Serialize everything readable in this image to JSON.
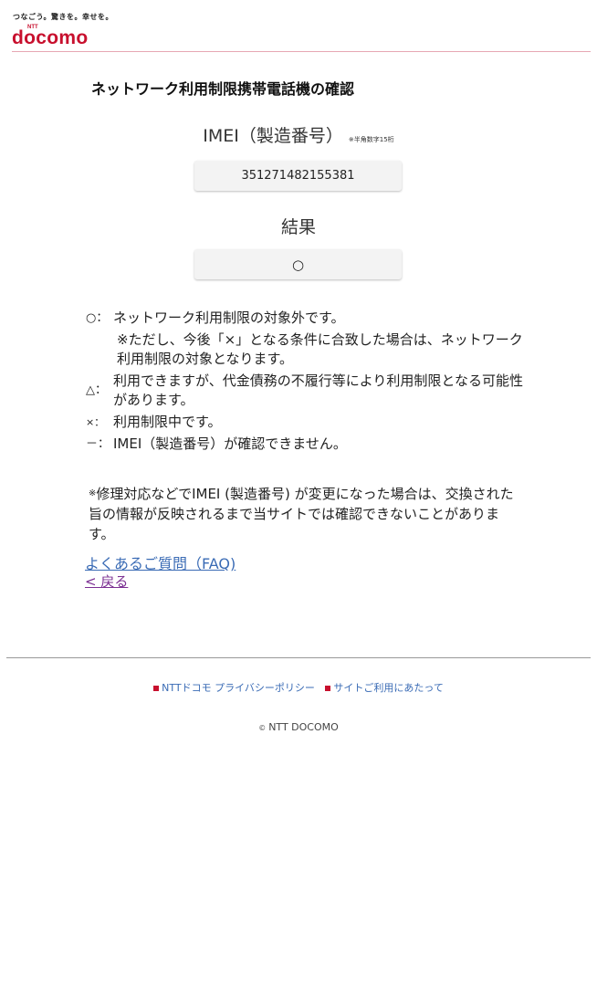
{
  "header": {
    "tagline": "つなごう。驚きを。幸せを。",
    "ntt": "NTT",
    "logo": "docomo"
  },
  "page_title": "ネットワーク利用制限携帯電話機の確認",
  "imei": {
    "label": "IMEI（製造番号）",
    "note": "※半角数字15桁",
    "value": "351271482155381"
  },
  "result": {
    "label": "結果",
    "value": "○"
  },
  "legend": {
    "circle_symbol": "○：",
    "circle_text": "ネットワーク利用制限の対象外です。",
    "circle_note": "※ただし、今後「×」となる条件に合致した場合は、ネットワーク利用制限の対象となります。",
    "triangle_symbol": "△：",
    "triangle_text": "利用できますが、代金債務の不履行等により利用制限となる可能性があります。",
    "cross_symbol": "×：",
    "cross_text": "利用制限中です。",
    "dash_symbol": "－：",
    "dash_text": "IMEI（製造番号）が確認できません。"
  },
  "remark": {
    "mark": "※",
    "text": "修理対応などでIMEI (製造番号) が変更になった場合は、交換された旨の情報が反映されるまで当サイトでは確認できないことがあります。"
  },
  "links": {
    "faq": "よくあるご質問（FAQ)",
    "back": "< 戻る"
  },
  "footer": {
    "privacy": "NTTドコモ プライバシーポリシー",
    "terms": "サイトご利用にあたって",
    "copyright_mark": "©",
    "copyright": "NTT DOCOMO"
  },
  "colors": {
    "brand_red": "#c8102e",
    "link_blue": "#3a6bb5",
    "visited_purple": "#7b2f92"
  }
}
